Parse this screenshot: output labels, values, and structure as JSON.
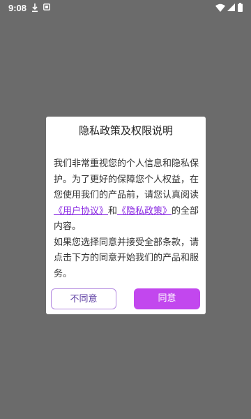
{
  "status_bar": {
    "time": "9:08",
    "icons": [
      "download-icon",
      "app-notification-icon",
      "wifi-icon",
      "signal-icon",
      "battery-icon"
    ]
  },
  "dialog": {
    "title": "隐私政策及权限说明",
    "body_intro": "我们非常重视您的个人信息和隐私保护。为了更好的保障您个人权益，在您使用我们的产品前，请您认真阅读",
    "link_user_agreement": "《用户协议》",
    "conjunction": "和",
    "link_privacy_policy": "《隐私政策》",
    "body_after_links": "的全部内容。",
    "body_second": "如果您选择同意并接受全部条款，请点击下方的同意开始我们的产品和服务。",
    "disagree_label": "不同意",
    "agree_label": "同意"
  },
  "colors": {
    "overlay": "#6b6b6b",
    "accent": "#c247ee",
    "link": "#8a2be2"
  }
}
